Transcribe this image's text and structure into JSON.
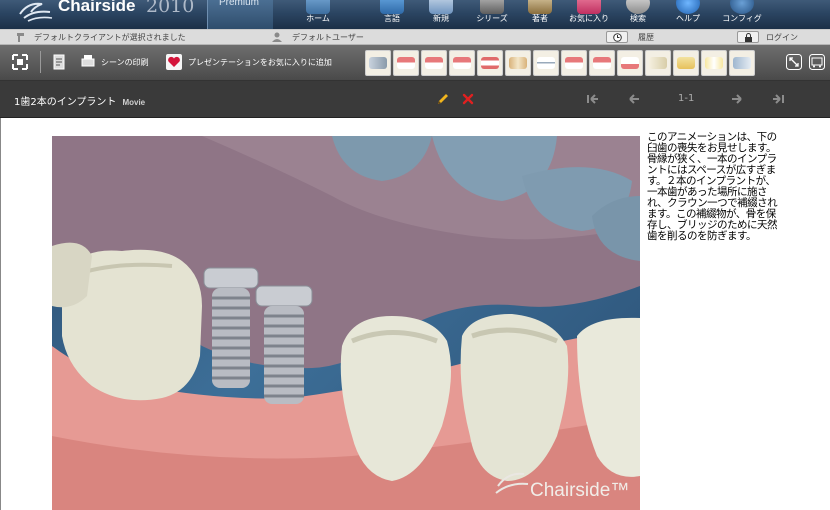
{
  "app": {
    "brand": "Chairside",
    "trademark": "®",
    "year": "2010",
    "edition": "Premium",
    "watermark": "Chairside™"
  },
  "nav": [
    {
      "label": "ホーム",
      "icon": "home-icon"
    },
    {
      "label": "言語",
      "icon": "language-icon"
    },
    {
      "label": "新規",
      "icon": "new-icon"
    },
    {
      "label": "シリーズ",
      "icon": "series-icon"
    },
    {
      "label": "著者",
      "icon": "author-icon"
    },
    {
      "label": "お気に入り",
      "icon": "favorites-icon"
    },
    {
      "label": "検索",
      "icon": "search-icon"
    },
    {
      "label": "ヘルプ",
      "icon": "help-icon"
    },
    {
      "label": "コンフィグ",
      "icon": "config-icon"
    }
  ],
  "status": {
    "client": "デフォルトクライアントが選択されました",
    "user": "デフォルトユーザー",
    "history": "履歴",
    "login": "ログイン"
  },
  "toolbar": {
    "print_scene": "シーンの印刷",
    "add_presentation": "プレゼンテーションをお気に入りに追加",
    "scene_thumbnails": [
      "instruments",
      "gum-recession",
      "bridge",
      "veneers",
      "smile",
      "implants",
      "braces",
      "crowns",
      "plaque",
      "molars",
      "root-canal",
      "floss",
      "whitening",
      "toothbrush"
    ]
  },
  "movie": {
    "title": "1歯2本のインプラント",
    "type": "Movie",
    "page": "1-1"
  },
  "description": "このアニメーションは、下の臼歯の喪失をお見せします。骨縁が狭く、一本のインプラントにはスペースが広すぎます。２本のインプラントが、一本歯があった場所に施され、クラウン一つで補綴されます。この補綴物が、骨を保存し、ブリッジのために天然歯を削るのを防ぎます。",
  "colors": {
    "nav_bg": "#2b4562",
    "toolbar_bg": "#5a5a5a",
    "titlebar_bg": "#3a3a3a",
    "edit_icon": "#f2b51d",
    "delete_icon": "#e02020"
  }
}
